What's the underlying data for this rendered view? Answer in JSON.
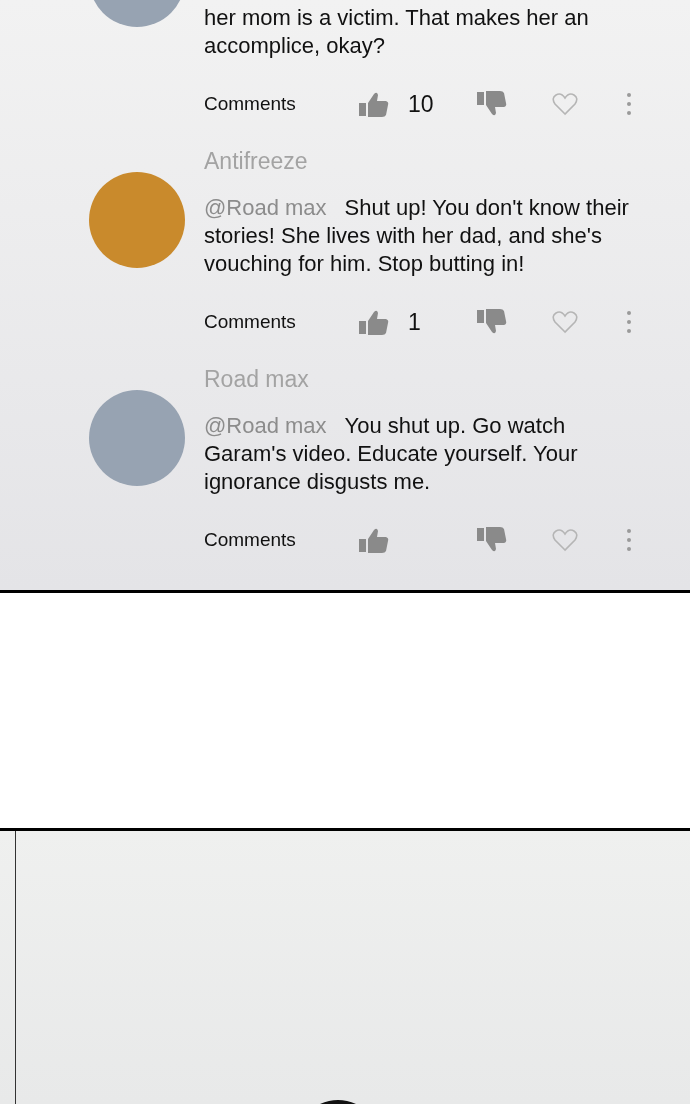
{
  "comments": [
    {
      "color": "#97a3b2",
      "body": "her mom is a victim. That makes her an accomplice, okay?",
      "action_label": "Comments",
      "like_count": "10"
    },
    {
      "color": "#c98a2c",
      "username": "Antifreeze",
      "mention": "@Road max",
      "body": "Shut up! You don't know their stories! She lives with her dad, and she's vouching for him. Stop butting in!",
      "action_label": "Comments",
      "like_count": "1"
    },
    {
      "color": "#97a3b2",
      "username": "Road max",
      "mention": "@Road max",
      "body": "You shut up. Go watch Garam's video. Educate yourself. Your ignorance disgusts me.",
      "action_label": "Comments"
    }
  ]
}
